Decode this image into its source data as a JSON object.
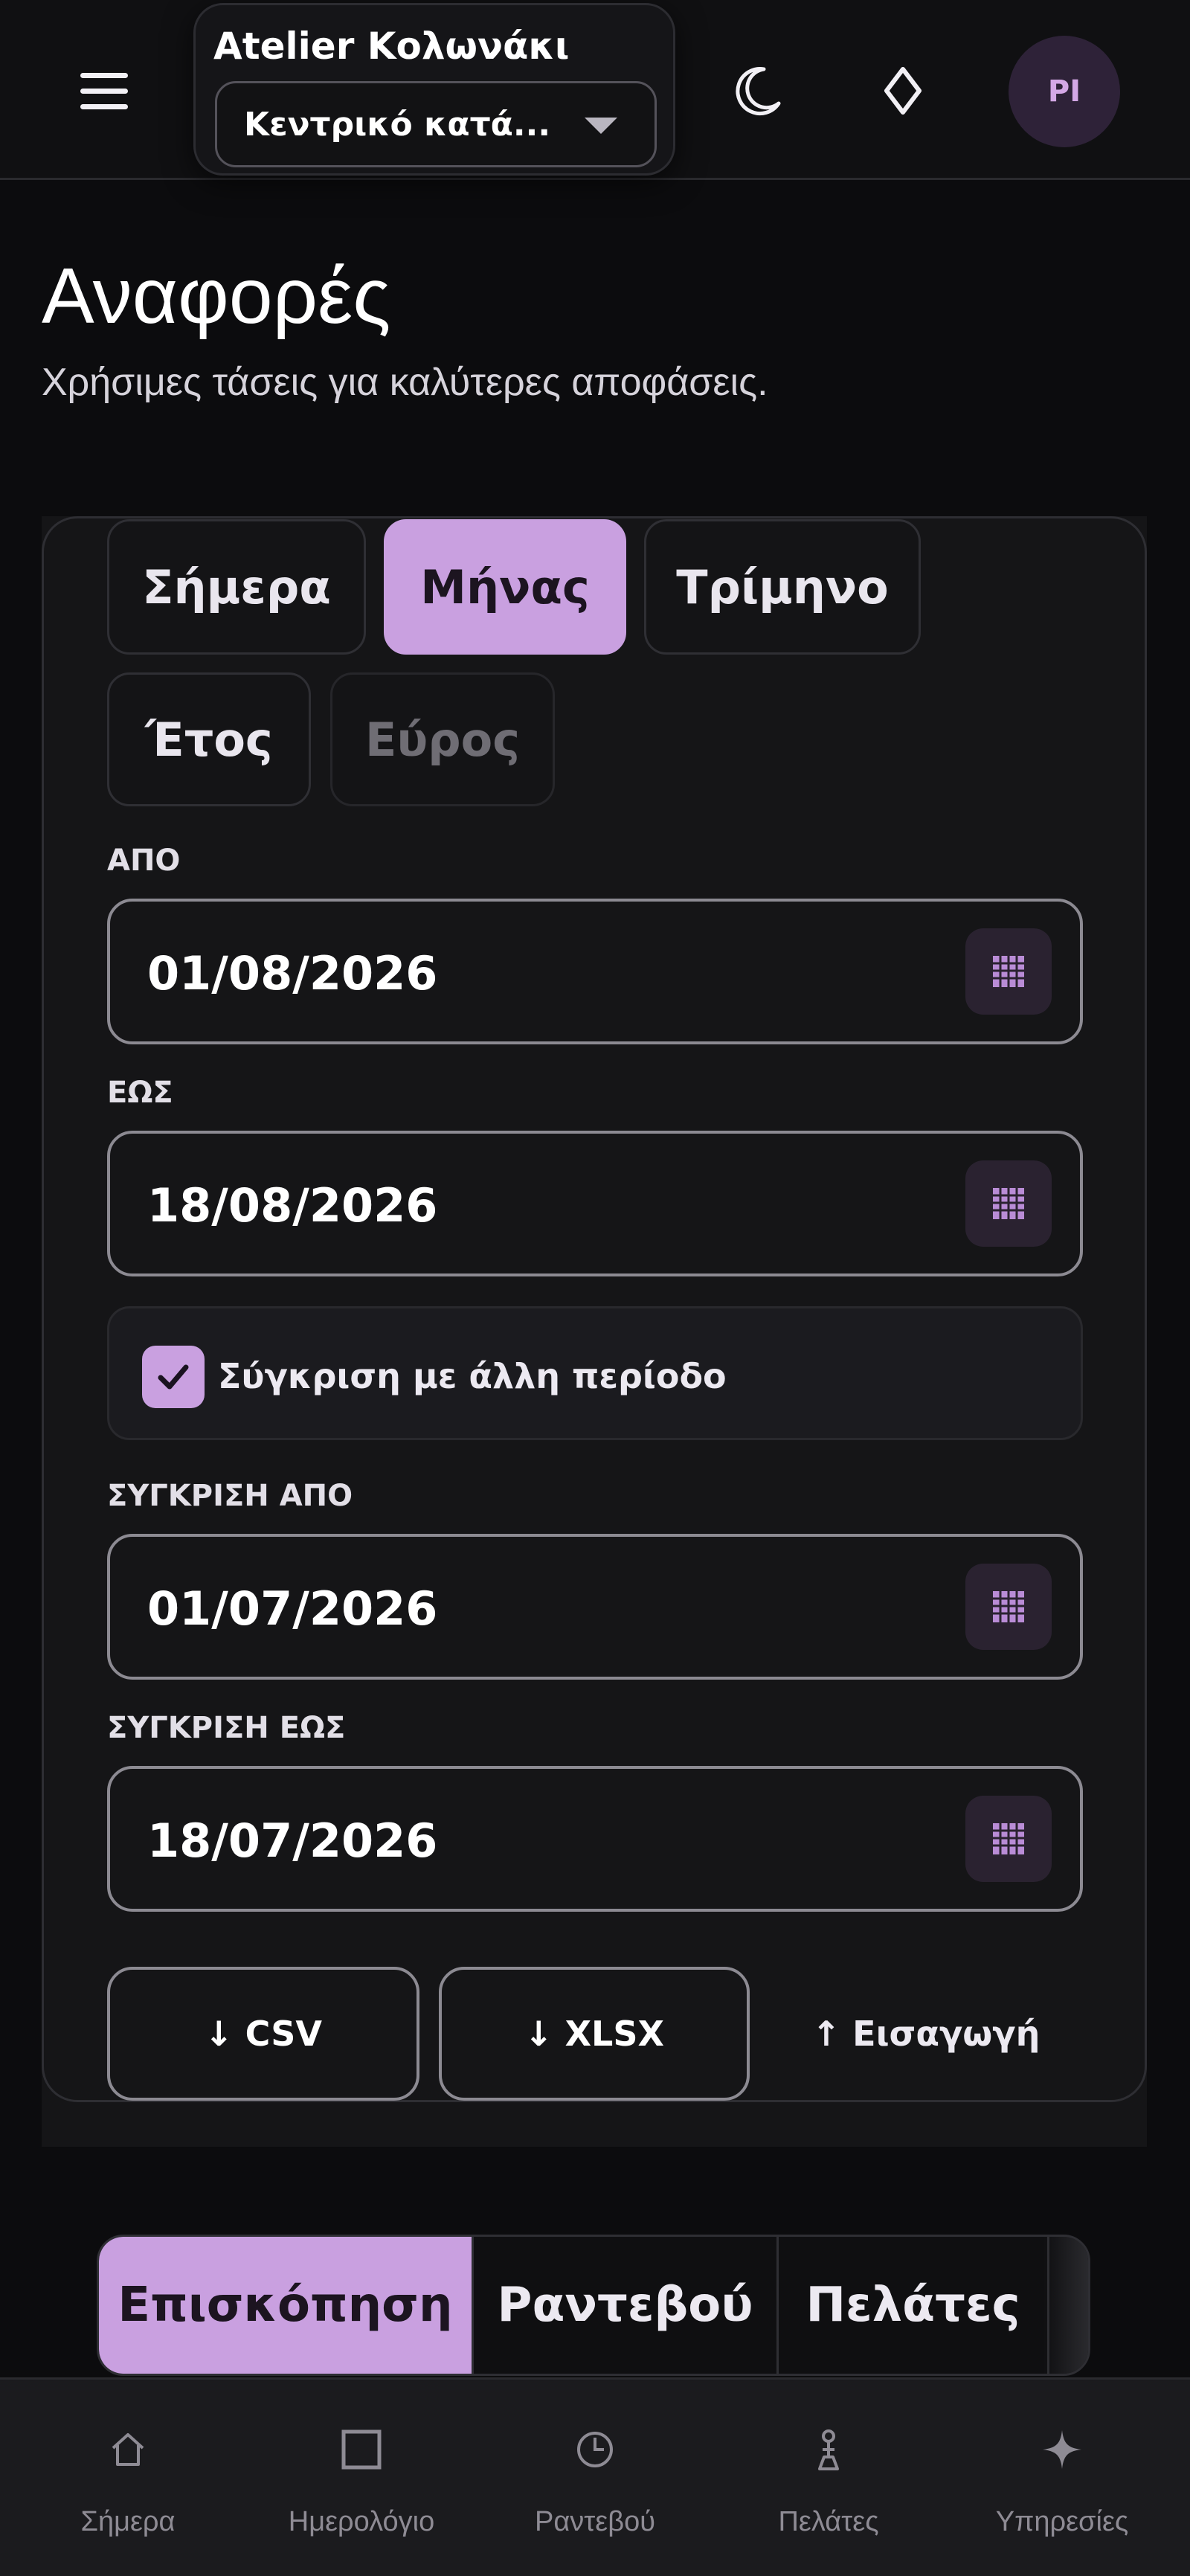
{
  "header": {
    "shop_name": "Atelier Κολωνάκι",
    "location_value": "Κεντρικό κατά...",
    "avatar_initials": "PI"
  },
  "page": {
    "title": "Αναφορές",
    "subtitle": "Χρήσιμες τάσεις για καλύτερες αποφάσεις."
  },
  "filters": {
    "periods": [
      {
        "label": "Σήμερα",
        "state": "default"
      },
      {
        "label": "Μήνας",
        "state": "active"
      },
      {
        "label": "Τρίμηνο",
        "state": "default"
      },
      {
        "label": "Έτος",
        "state": "default"
      },
      {
        "label": "Εύρος",
        "state": "disabled"
      }
    ],
    "from_label": "ΑΠΟ",
    "from_value": "01/08/2026",
    "to_label": "ΕΩΣ",
    "to_value": "18/08/2026",
    "compare_label": "Σύγκριση με άλλη περίοδο",
    "compare_checked": true,
    "compare_from_label": "ΣΥΓΚΡΙΣΗ ΑΠΟ",
    "compare_from_value": "01/07/2026",
    "compare_to_label": "ΣΥΓΚΡΙΣΗ ΕΩΣ",
    "compare_to_value": "18/07/2026",
    "export_csv": "↓ CSV",
    "export_xlsx": "↓ XLSX",
    "import": "↑ Εισαγωγή"
  },
  "tabs": [
    {
      "label": "Επισκόπηση",
      "active": true
    },
    {
      "label": "Ραντεβού",
      "active": false
    },
    {
      "label": "Πελάτες",
      "active": false
    }
  ],
  "bottom_nav": [
    {
      "label": "Σήμερα",
      "icon": "home-icon"
    },
    {
      "label": "Ημερολόγιο",
      "icon": "square-icon"
    },
    {
      "label": "Ραντεβού",
      "icon": "clock-icon"
    },
    {
      "label": "Πελάτες",
      "icon": "person-icon"
    },
    {
      "label": "Υπηρεσίες",
      "icon": "sparkle-icon"
    }
  ],
  "colors": {
    "accent": "#c9a0e0",
    "background": "#0c0c0e",
    "panel": "#151517",
    "avatar_bg": "#2e2238"
  }
}
